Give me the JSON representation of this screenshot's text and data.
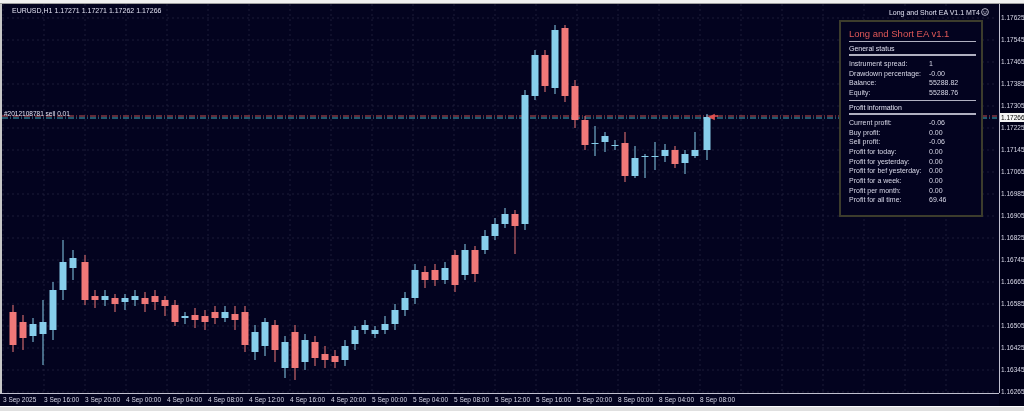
{
  "chart": {
    "symbol_line": "EURUSD,H1  1.17271 1.17271 1.17262 1.17266",
    "indicator_label": "Long and Short EA V1.1 MT4",
    "order_label": "#2012108781 sell 0.01"
  },
  "panel": {
    "title": "Long and Short EA v1.1",
    "sections": [
      {
        "heading": "General status",
        "rows": [
          {
            "label": "Instrument spread:",
            "value": "1"
          },
          {
            "label": "Drawdown percentage:",
            "value": "-0.00"
          },
          {
            "label": "Balance:",
            "value": "55288.82"
          },
          {
            "label": "Equity:",
            "value": "55288.76"
          }
        ]
      },
      {
        "heading": "Profit information",
        "rows": [
          {
            "label": "Current profit:",
            "value": "-0.06"
          },
          {
            "label": "Buy profit:",
            "value": "0.00"
          },
          {
            "label": "Sell profit:",
            "value": "-0.06"
          },
          {
            "label": "Profit for today:",
            "value": "0.00"
          },
          {
            "label": "Profit for yesterday:",
            "value": "0.00"
          },
          {
            "label": "Profit for bef yesterday:",
            "value": "0.00"
          },
          {
            "label": "Profit for a week:",
            "value": "0.00"
          },
          {
            "label": "Profit per month:",
            "value": "0.00"
          },
          {
            "label": "Profit for all time:",
            "value": "69.46"
          }
        ]
      }
    ]
  },
  "price_axis": {
    "ticks": [
      "1.17625",
      "1.17545",
      "1.17465",
      "1.17385",
      "1.17305",
      "1.17225",
      "1.17145",
      "1.17065",
      "1.16985",
      "1.16905",
      "1.16825",
      "1.16745",
      "1.16665",
      "1.16585",
      "1.16505",
      "1.16425",
      "1.16345",
      "1.16265"
    ],
    "current_price": "1.17266"
  },
  "time_axis": {
    "labels": [
      "3 Sep 2025",
      "3 Sep 16:00",
      "3 Sep 20:00",
      "4 Sep 00:00",
      "4 Sep 04:00",
      "4 Sep 08:00",
      "4 Sep 12:00",
      "4 Sep 16:00",
      "4 Sep 20:00",
      "5 Sep 00:00",
      "5 Sep 04:00",
      "5 Sep 08:00",
      "5 Sep 12:00",
      "5 Sep 16:00",
      "5 Sep 20:00",
      "8 Sep 00:00",
      "8 Sep 04:00",
      "8 Sep 08:00"
    ]
  }
}
